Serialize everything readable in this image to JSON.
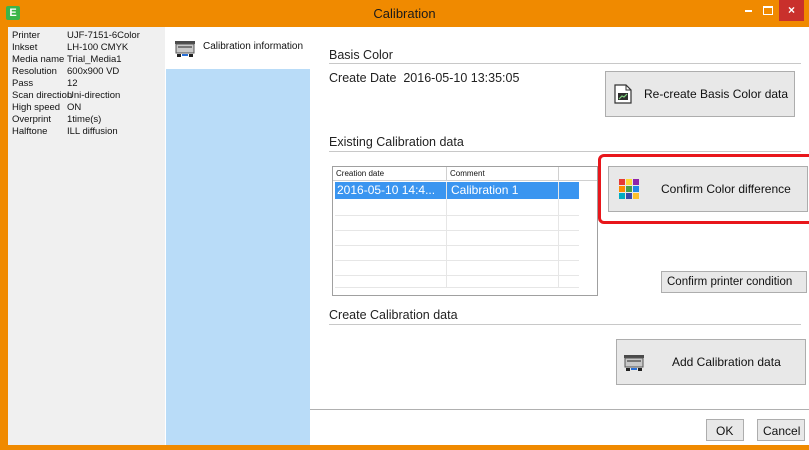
{
  "window": {
    "title": "Calibration",
    "app_icon_letter": "E",
    "minimize_icon": "minimize-icon",
    "maximize_icon": "maximize-icon",
    "close_glyph": "×"
  },
  "info": [
    {
      "key": "Printer",
      "value": "UJF-7151-6Color"
    },
    {
      "key": "Inkset",
      "value": "LH-100 CMYK"
    },
    {
      "key": "Media name",
      "value": "Trial_Media1"
    },
    {
      "key": "Resolution",
      "value": "600x900 VD"
    },
    {
      "key": "Pass",
      "value": "12"
    },
    {
      "key": "Scan direction",
      "value": "Uni-direction"
    },
    {
      "key": "High speed",
      "value": "ON"
    },
    {
      "key": "Overprint",
      "value": "1time(s)"
    },
    {
      "key": "Halftone",
      "value": "ILL diffusion"
    }
  ],
  "nav": {
    "items": [
      {
        "label": "Calibration information",
        "icon": "printer-icon"
      }
    ]
  },
  "basis": {
    "title": "Basis Color",
    "create_date_label": "Create Date",
    "create_date_value": "2016-05-10 13:35:05",
    "recreate_button": "Re-create Basis Color data"
  },
  "existing": {
    "title": "Existing Calibration data",
    "columns": [
      "Creation date",
      "Comment"
    ],
    "rows": [
      {
        "date": "2016-05-10 14:4...",
        "comment": "Calibration 1"
      }
    ],
    "confirm_color_button": "Confirm Color difference",
    "confirm_printer_button": "Confirm printer condition"
  },
  "create": {
    "title": "Create Calibration data",
    "add_button": "Add Calibration data"
  },
  "footer": {
    "ok": "OK",
    "cancel": "Cancel"
  },
  "colors": {
    "title_bar": "#f08a00",
    "nav_background": "#b9dcf8",
    "selection": "#3a95f0",
    "highlight": "#e8161b"
  }
}
